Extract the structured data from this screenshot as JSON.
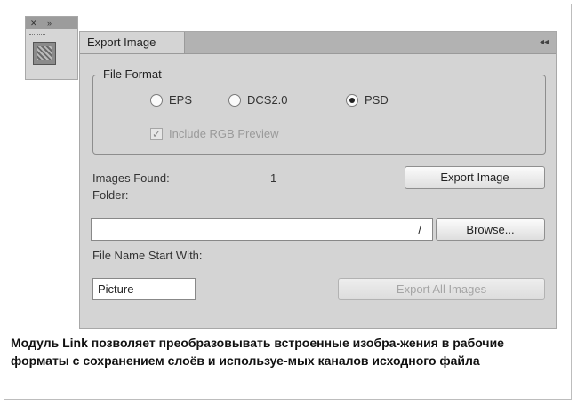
{
  "side_panel": {
    "close_glyph": "✕",
    "expand_glyph": "»"
  },
  "panel": {
    "tab_label": "Export Image",
    "collapse_glyph": "◂◂",
    "file_format": {
      "legend": "File Format",
      "options": [
        {
          "label": "EPS",
          "selected": false
        },
        {
          "label": "DCS2.0",
          "selected": false
        },
        {
          "label": "PSD",
          "selected": true
        }
      ],
      "include_preview": {
        "label": "Include RGB Preview",
        "checked": true,
        "enabled": false
      }
    },
    "images_found_label": "Images Found:",
    "images_found_value": "1",
    "export_image_button": "Export Image",
    "folder_label": "Folder:",
    "folder_value": "/",
    "browse_button": "Browse...",
    "file_name_label": "File Name Start With:",
    "file_name_value": "Picture",
    "export_all_button": "Export All Images"
  },
  "caption": "Модуль Link позволяет преобразовывать встроенные изобра-жения в рабочие форматы с сохранением слоёв и используе-мых каналов исходного файла"
}
